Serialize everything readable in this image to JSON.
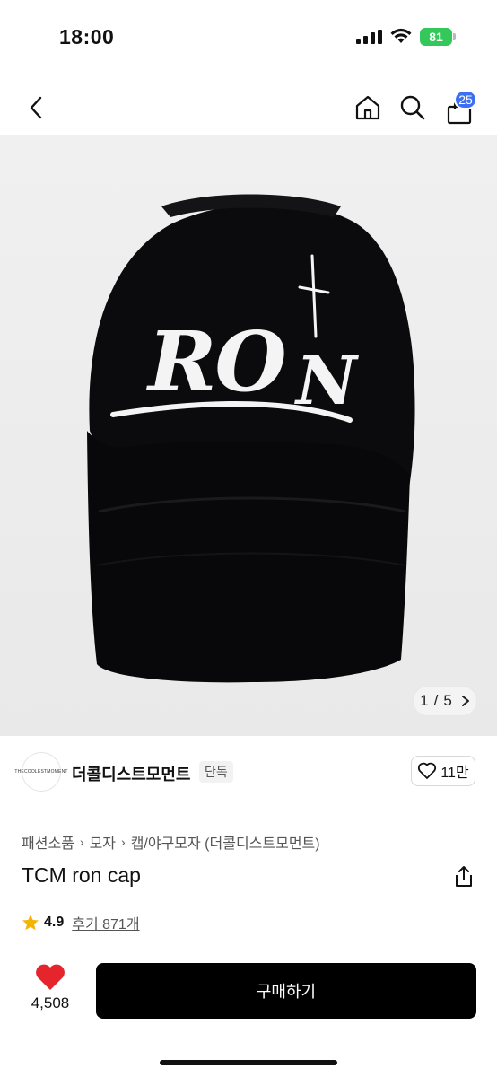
{
  "status_bar": {
    "time": "18:00",
    "battery": "81"
  },
  "nav": {
    "cart_count": "25",
    "icons": [
      "chevron-left-icon",
      "home-icon",
      "search-icon",
      "shopping-bag-icon"
    ]
  },
  "hero": {
    "image_description_icon": "black-baseball-cap-image",
    "cap_text": "RON",
    "page_current": "1",
    "page_separator": "/",
    "page_total": "5"
  },
  "brand": {
    "logo_text": "THECOOLESTMOMENT",
    "name": "더콜디스트모먼트",
    "tag": "단독",
    "like_count": "11만"
  },
  "breadcrumb": {
    "items": [
      "패션소품",
      "모자",
      "캡/야구모자 (더콜디스트모먼트)"
    ]
  },
  "product": {
    "title": "TCM ron cap"
  },
  "rating": {
    "value": "4.9",
    "review_label": "후기 871개"
  },
  "bottom": {
    "wish_count": "4,508",
    "buy_label": "구매하기"
  },
  "colors": {
    "accent_blue": "#3d6ff5",
    "battery_green": "#34c759",
    "heart_red": "#e5242b",
    "star_yellow": "#f5b400",
    "buy_button": "#000000"
  }
}
